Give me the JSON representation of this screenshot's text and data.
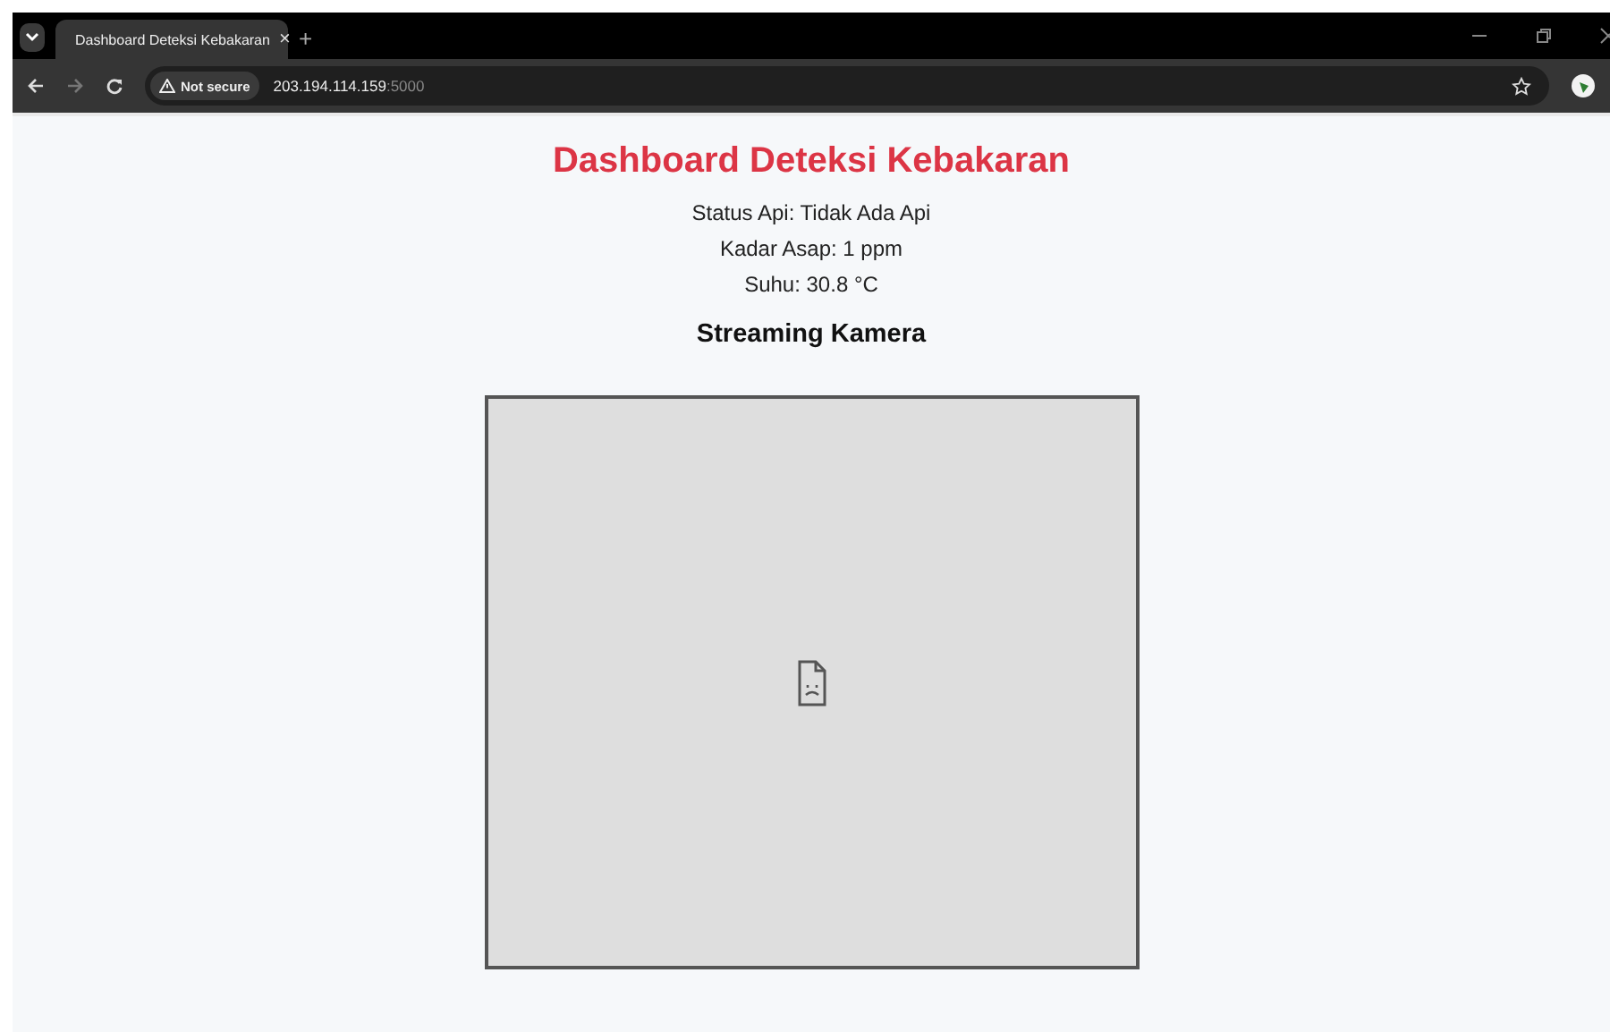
{
  "browser": {
    "tab": {
      "title": "Dashboard Deteksi Kebakaran",
      "close": "×",
      "selected": true
    },
    "new_tab": "+",
    "security": "Not secure",
    "url_host": "203.194.114.159",
    "url_port": ":5000"
  },
  "page": {
    "title": "Dashboard Deteksi Kebakaran",
    "readings": [
      {
        "text": "Status Api: Tidak Ada Api"
      },
      {
        "text": "Kadar Asap: 1 ppm"
      },
      {
        "text": "Suhu: 30.8 °C"
      }
    ],
    "section_heading": "Streaming Kamera",
    "camera": {
      "kind": "broken-image"
    }
  }
}
